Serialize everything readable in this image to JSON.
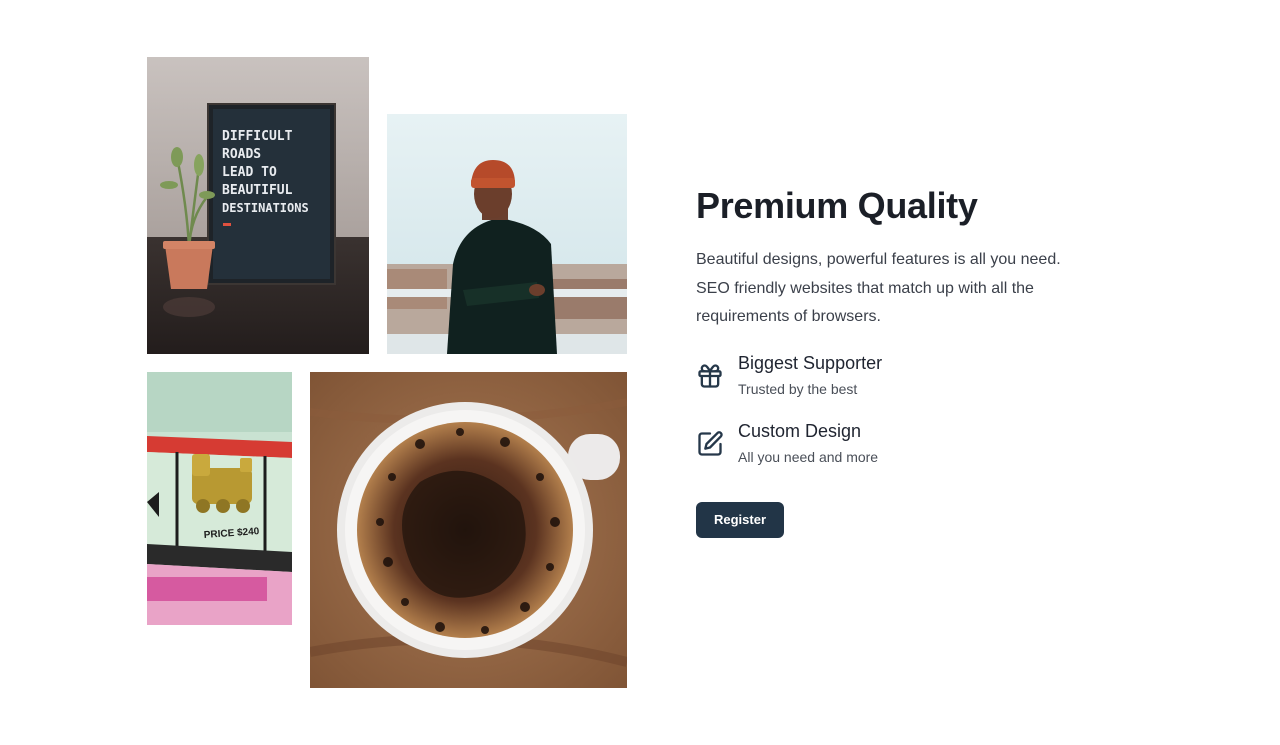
{
  "gallery": {
    "letterboard_lines": [
      "DIFFICULT",
      "ROADS",
      "LEAD TO",
      "BEAUTIFUL",
      "DESTINATIONS"
    ],
    "board_price": "PRICE $240"
  },
  "content": {
    "title": "Premium Quality",
    "description": "Beautiful designs, powerful features is all you need. SEO friendly websites that match up with all the requirements of browsers.",
    "features": [
      {
        "icon": "gift-icon",
        "title": "Biggest Supporter",
        "subtitle": "Trusted by the best"
      },
      {
        "icon": "edit-icon",
        "title": "Custom Design",
        "subtitle": "All you need and more"
      }
    ],
    "cta_label": "Register"
  },
  "colors": {
    "accent": "#223547",
    "text": "#1f2430"
  }
}
